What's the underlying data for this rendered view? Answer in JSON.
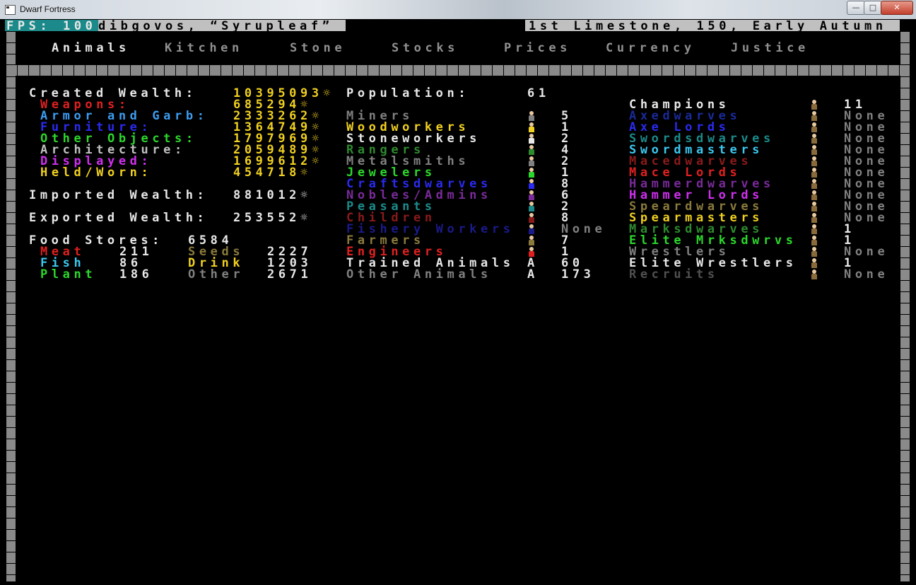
{
  "window": {
    "title": "Dwarf Fortress",
    "minimize": "—",
    "maximize": "□",
    "close": "✕"
  },
  "status": {
    "fps_label": "FPS:",
    "fps_value": "100",
    "fortress": "dibgovos, “Syrupleaf”",
    "date": "1st Limestone, 150, Early Autumn"
  },
  "tabs": [
    "Animals",
    "Kitchen",
    "Stone",
    "Stocks",
    "Prices",
    "Currency",
    "Justice"
  ],
  "wealth": {
    "created_label": "Created Wealth:",
    "created_value": "10395093",
    "items": [
      {
        "label": "Weapons:",
        "value": "685294",
        "color": "#e02020"
      },
      {
        "label": "Armor and Garb:",
        "value": "2333262",
        "color": "#3c9cf0"
      },
      {
        "label": "Furniture:",
        "value": "1364749",
        "color": "#2a2af0"
      },
      {
        "label": "Other Objects:",
        "value": "1797969",
        "color": "#2cd72c"
      },
      {
        "label": "Architecture:",
        "value": "2059489",
        "color": "#c0c0c0"
      },
      {
        "label": "Displayed:",
        "value": "1699612",
        "color": "#d030f0"
      },
      {
        "label": "Held/Worn:",
        "value": "454718",
        "color": "#f0d020"
      }
    ],
    "imported_label": "Imported Wealth:",
    "imported_value": "881012",
    "exported_label": "Exported Wealth:",
    "exported_value": "253552",
    "currency_icon": "sun-currency-icon"
  },
  "food": {
    "label": "Food Stores:",
    "total": "6584",
    "rows": [
      [
        {
          "label": "Meat",
          "value": "211",
          "color": "#e02020"
        },
        {
          "label": "Seeds",
          "value": "2227",
          "color": "#8a7a3c"
        }
      ],
      [
        {
          "label": "Fish",
          "value": "86",
          "color": "#3cc8f0"
        },
        {
          "label": "Drink",
          "value": "1203",
          "color": "#f0d020"
        }
      ],
      [
        {
          "label": "Plant",
          "value": "186",
          "color": "#2cd72c"
        },
        {
          "label": "Other",
          "value": "2671",
          "color": "#808080"
        }
      ]
    ]
  },
  "population": {
    "label": "Population:",
    "total": "61",
    "rows": [
      {
        "label": "Miners",
        "value": "5",
        "color": "#808080"
      },
      {
        "label": "Woodworkers",
        "value": "1",
        "color": "#f0d020"
      },
      {
        "label": "Stoneworkers",
        "value": "2",
        "color": "#e8e8e8"
      },
      {
        "label": "Rangers",
        "value": "4",
        "color": "#2e8a2e"
      },
      {
        "label": "Metalsmiths",
        "value": "2",
        "color": "#808080"
      },
      {
        "label": "Jewelers",
        "value": "1",
        "color": "#2cd72c"
      },
      {
        "label": "Craftsdwarves",
        "value": "8",
        "color": "#2a2af0"
      },
      {
        "label": "Nobles/Admins",
        "value": "6",
        "color": "#7a2a9a"
      },
      {
        "label": "Peasants",
        "value": "2",
        "color": "#1c8a8a"
      },
      {
        "label": "Children",
        "value": "8",
        "color": "#8a1a1a"
      },
      {
        "label": "Fishery Workers",
        "value": "None",
        "color": "#1a1a8a"
      },
      {
        "label": "Farmers",
        "value": "7",
        "color": "#8a7a3c"
      },
      {
        "label": "Engineers",
        "value": "1",
        "color": "#e02020"
      },
      {
        "label": "Trained Animals",
        "value": "60",
        "color": "#e8e8e8",
        "glyph": "A"
      },
      {
        "label": "Other Animals",
        "value": "173",
        "color": "#808080",
        "glyph": "A"
      }
    ]
  },
  "military": [
    {
      "label": "Champions",
      "value": "11",
      "color": "#e8e8e8"
    },
    {
      "label": "Axedwarves",
      "value": "None",
      "color": "#1a2a9a"
    },
    {
      "label": "Axe Lords",
      "value": "None",
      "color": "#2a2af0"
    },
    {
      "label": "Swordsdwarves",
      "value": "None",
      "color": "#1c8a8a"
    },
    {
      "label": "Swordmasters",
      "value": "None",
      "color": "#3cc8f0"
    },
    {
      "label": "Macedwarves",
      "value": "None",
      "color": "#8a1a1a"
    },
    {
      "label": "Mace Lords",
      "value": "None",
      "color": "#e02020"
    },
    {
      "label": "Hammerdwarves",
      "value": "None",
      "color": "#7a2a9a"
    },
    {
      "label": "Hammer Lords",
      "value": "None",
      "color": "#d030f0"
    },
    {
      "label": "Speardwarves",
      "value": "None",
      "color": "#8a7a3c"
    },
    {
      "label": "Spearmasters",
      "value": "None",
      "color": "#f0d020"
    },
    {
      "label": "Marksdwarves",
      "value": "1",
      "color": "#2e8a2e"
    },
    {
      "label": "Elite Mrksdwrvs",
      "value": "1",
      "color": "#2cd72c"
    },
    {
      "label": "Wrestlers",
      "value": "None",
      "color": "#808080"
    },
    {
      "label": "Elite Wrestlers",
      "value": "1",
      "color": "#e8e8e8"
    },
    {
      "label": "Recruits",
      "value": "None",
      "color": "#505050"
    }
  ],
  "colors": {
    "yellow": "#f0d020",
    "white": "#e8e8e8",
    "grey": "#909090",
    "status_bg": "#c0c0c0",
    "fps_bg": "#1c8a8a"
  }
}
